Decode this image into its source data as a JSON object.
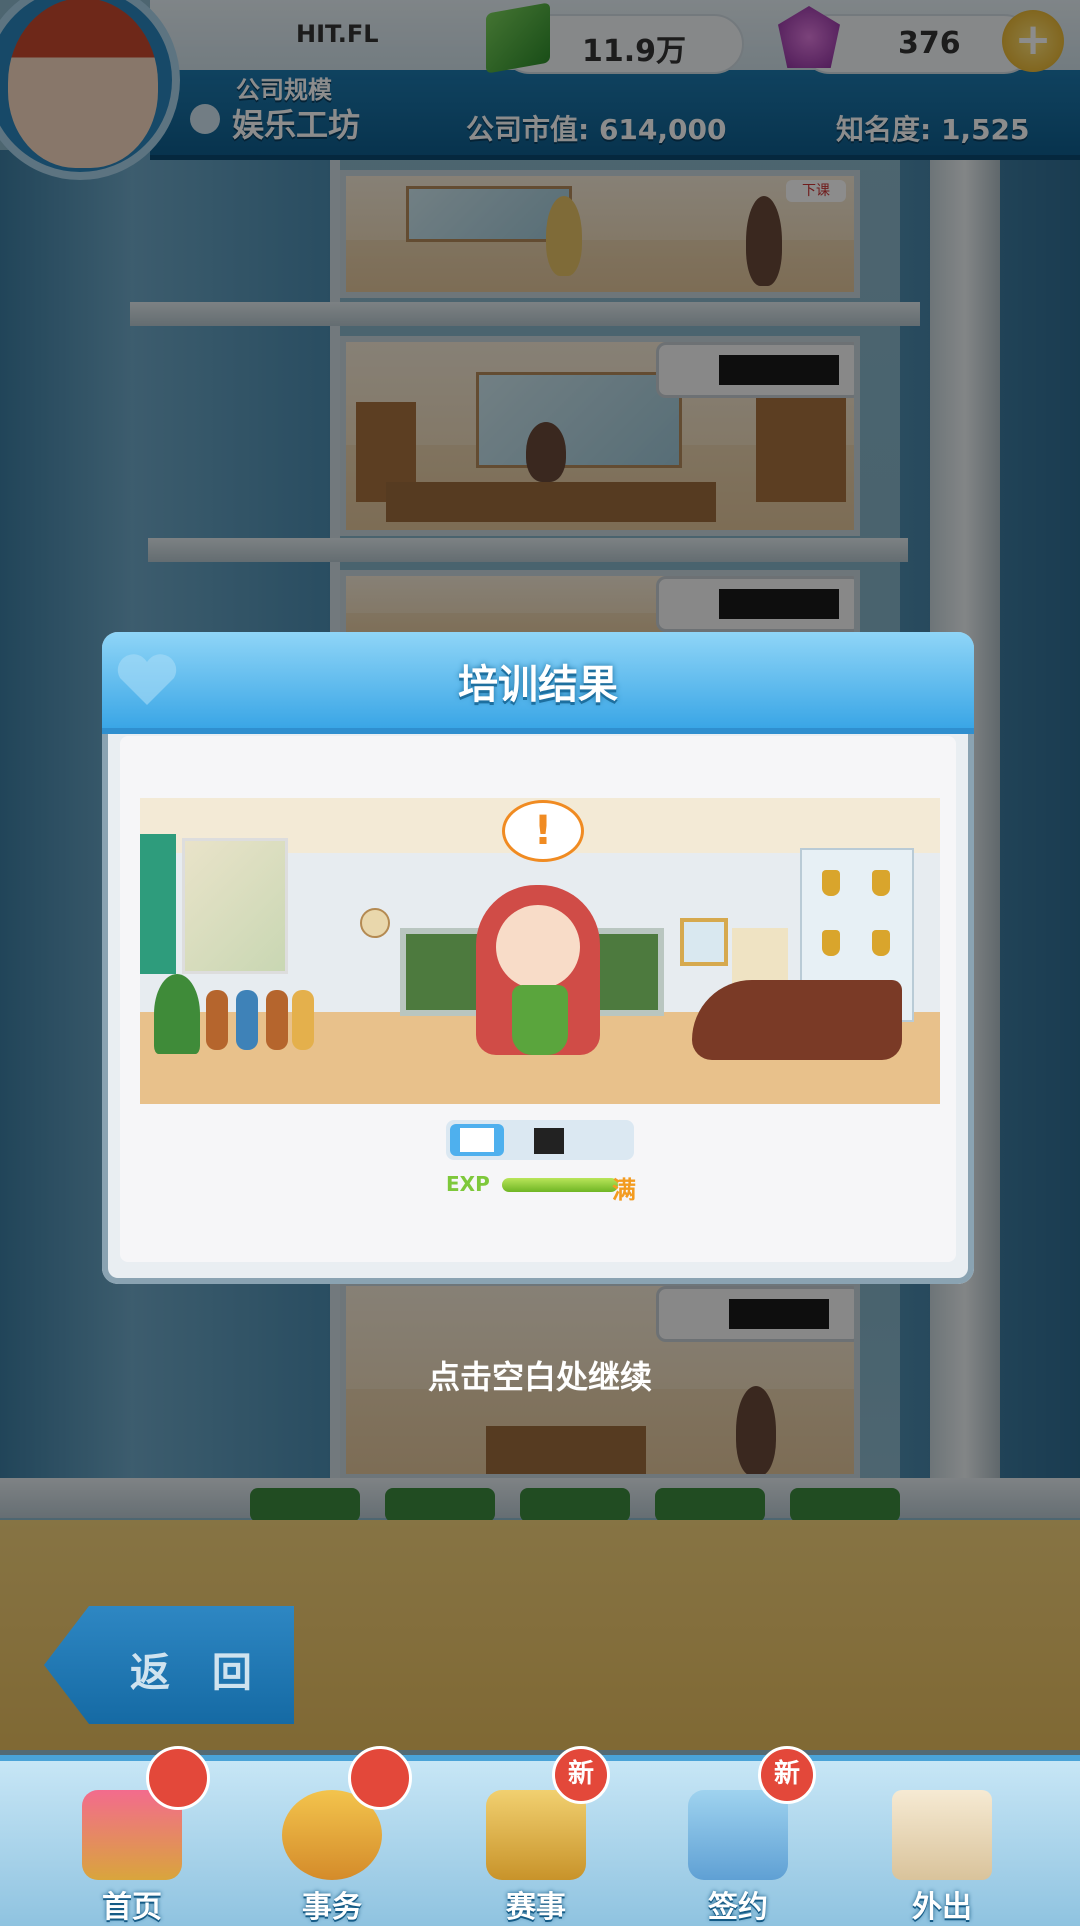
{
  "hud": {
    "player_name": "HIT.FL",
    "money": "11.9万",
    "gems": "376",
    "company_scale_label": "公司规模",
    "company_scale_value": "娱乐工坊",
    "market_value": "公司市值: 614,000",
    "fame": "知名度: 1,525",
    "add_icon_symbol": "+"
  },
  "building": {
    "floor_tag": "下课"
  },
  "modal": {
    "title": "培训结果",
    "alert_symbol": "!",
    "exp_label": "EXP",
    "exp_progress": 1.0,
    "exp_full_label": "满"
  },
  "continue_hint": "点击空白处继续",
  "back_button": "返 回",
  "nav": [
    {
      "label": "首页",
      "icon": "home-icon",
      "badge": ""
    },
    {
      "label": "事务",
      "icon": "affairs-icon",
      "badge": ""
    },
    {
      "label": "赛事",
      "icon": "trophy-icon",
      "badge": "新"
    },
    {
      "label": "签约",
      "icon": "contract-icon",
      "badge": "新"
    },
    {
      "label": "外出",
      "icon": "door-icon",
      "badge": ""
    }
  ],
  "colors": {
    "accent": "#3aa6e6",
    "exp_fill": "#7ec83b",
    "badge": "#e3483a"
  }
}
